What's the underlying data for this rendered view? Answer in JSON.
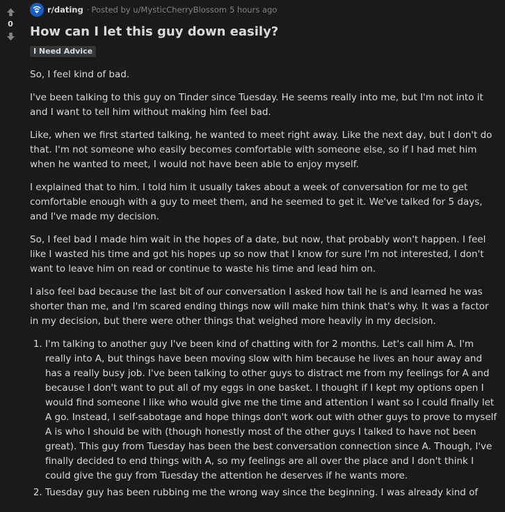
{
  "vote": {
    "count": "0"
  },
  "post": {
    "subreddit": "r/dating",
    "separator": "·",
    "posted_by": "Posted by u/MysticCherryBlossom",
    "time": "5 hours ago",
    "title": "How can I let this guy down easily?",
    "flair": "I Need Advice",
    "paragraphs": [
      "So, I feel kind of bad.",
      "I've been talking to this guy on Tinder since Tuesday. He seems really into me, but I'm not into it and I want to tell him without making him feel bad.",
      "Like, when we first started talking, he wanted to meet right away. Like the next day, but I don't do that. I'm not someone who easily becomes comfortable with someone else, so if I had met him when he wanted to meet, I would not have been able to enjoy myself.",
      "I explained that to him. I told him it usually takes about a week of conversation for me to get comfortable enough with a guy to meet them, and he seemed to get it. We've talked for 5 days, and I've made my decision.",
      "So, I feel bad I made him wait in the hopes of a date, but now, that probably won't happen. I feel like I wasted his time and got his hopes up so now that I know for sure I'm not interested, I don't want to leave him on read or continue to waste his time and lead him on.",
      "I also feel bad because the last bit of our conversation I asked how tall he is and learned he was shorter than me, and I'm scared ending things now will make him think that's why. It was a factor in my decision, but there were other things that weighed more heavily in my decision."
    ],
    "list_items": [
      "I'm talking to another guy I've been kind of chatting with for 2 months. Let's call him A. I'm really into A, but things have been moving slow with him because he lives an hour away and has a really busy job. I've been talking to other guys to distract me from my feelings for A and because I don't want to put all of my eggs in one basket. I thought if I kept my options open I would find someone I like who would give me the time and attention I want so I could finally let A go. Instead, I self-sabotage and hope things don't work out with other guys to prove to myself A is who I should be with (though honestly most of the other guys I talked to have not been great). This guy from Tuesday has been the best conversation connection since A. Though, I've finally decided to end things with A, so my feelings are all over the place and I don't think I could give the guy from Tuesday the attention he deserves if he wants more.",
      "Tuesday guy has been rubbing me the wrong way since the beginning. I was already kind of"
    ]
  },
  "icons": {
    "upvote": "upvote-arrow-icon",
    "downvote": "downvote-arrow-icon",
    "subreddit": "subreddit-wifi-heart-icon"
  },
  "colors": {
    "background": "#1a1a1b",
    "text": "#d7dadc",
    "muted": "#818384",
    "flair_bg": "#343536",
    "subreddit_icon_bg": "#1a5cc4"
  }
}
